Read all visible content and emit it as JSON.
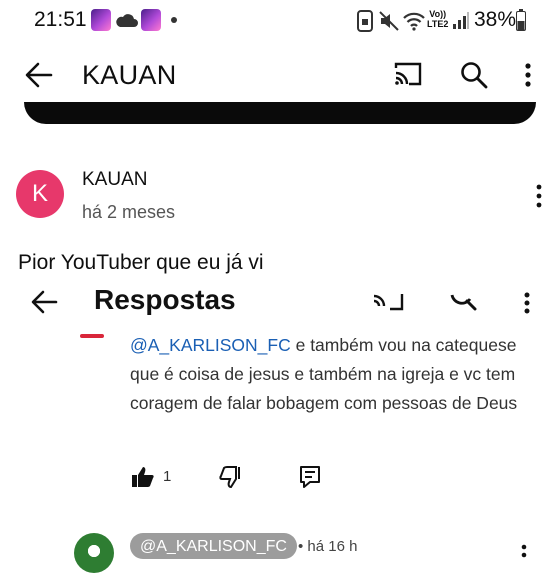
{
  "status_bar": {
    "time": "21:51",
    "battery": "38%",
    "network_top": "Vo))",
    "network_bottom": "LTE2"
  },
  "header": {
    "title": "KAUAN"
  },
  "comment": {
    "avatar_letter": "K",
    "author": "KAUAN",
    "time": "há 2 meses",
    "text": "Pior YouTuber que eu já vi"
  },
  "replies_panel": {
    "title": "Respostas",
    "reply": {
      "mention": "@A_KARLISON_FC",
      "text": " e também vou na catequese que é coisa de jesus e também na igreja e vc tem coragem de falar bobagem com pessoas de Deus",
      "likes": "1"
    },
    "next_reply": {
      "author": "@A_KARLISON_FC",
      "time": "• há 16 h"
    }
  },
  "colors": {
    "avatar": "#e7386b",
    "mention": "#1a5fb4",
    "chip": "#9c9c9c"
  }
}
